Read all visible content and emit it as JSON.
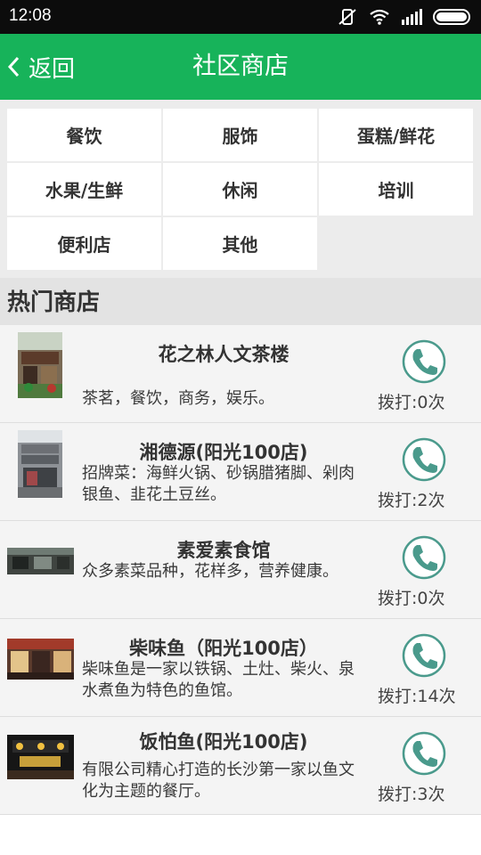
{
  "status_bar": {
    "time": "12:08"
  },
  "header": {
    "back_label": "返回",
    "title": "社区商店"
  },
  "categories": [
    "餐饮",
    "服饰",
    "蛋糕/鲜花",
    "水果/生鲜",
    "休闲",
    "培训",
    "便利店",
    "其他"
  ],
  "section_title": "热门商店",
  "shops": [
    {
      "name": "花之林人文茶楼",
      "desc": "茶茗，餐饮，商务，娱乐。",
      "calls": "拨打:0次"
    },
    {
      "name": "湘德源(阳光100店)",
      "desc": "招牌菜：海鲜火锅、砂锅腊猪脚、剁肉银鱼、韭花土豆丝。",
      "calls": "拨打:2次"
    },
    {
      "name": "素爱素食馆",
      "desc": "众多素菜品种，花样多，营养健康。",
      "calls": "拨打:0次"
    },
    {
      "name": "柴味鱼（阳光100店）",
      "desc": "柴味鱼是一家以铁锅、土灶、柴火、泉水煮鱼为特色的鱼馆。",
      "calls": "拨打:14次"
    },
    {
      "name": "饭怕鱼(阳光100店)",
      "desc": "有限公司精心打造的长沙第一家以鱼文化为主题的餐厅。",
      "calls": "拨打:3次"
    }
  ],
  "colors": {
    "accent": "#17b35a",
    "phone_icon": "#4a9a8c"
  }
}
